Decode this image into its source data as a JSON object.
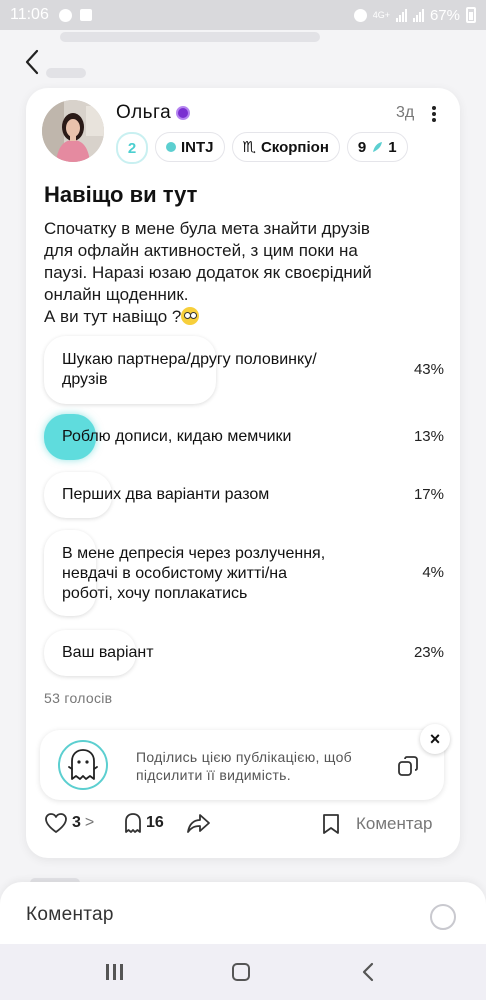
{
  "status_bar": {
    "time": "11:06",
    "network": "4G+",
    "battery": "67%"
  },
  "post": {
    "author": "Ольга",
    "time_ago": "3д",
    "level": "2",
    "mbti": "INTJ",
    "zodiac_symbol": "♏",
    "zodiac": "Скорпіон",
    "stat_left": "9",
    "stat_right": "1",
    "title": "Навіщо ви тут",
    "body": "Спочатку в мене була мета знайти друзів\nдля офлайн активностей, з цим поки на\nпаузі. Наразі юзаю додаток як своєрідний\nонлайн щоденник.\nА ви тут навіщо ?"
  },
  "poll": {
    "options": [
      {
        "text": "Шукаю партнера/другу половинку/\nдрузів",
        "percent_label": "43%",
        "percent": 43,
        "selected": false
      },
      {
        "text": "Роблю дописи, кидаю мемчики",
        "percent_label": "13%",
        "percent": 13,
        "selected": true
      },
      {
        "text": "Перших два варіанти разом",
        "percent_label": "17%",
        "percent": 17,
        "selected": false
      },
      {
        "text": "В мене депресія через розлучення,\nневдачі в особистому житті/на\nроботі, хочу поплакатись",
        "percent_label": "4%",
        "percent": 4,
        "selected": false
      },
      {
        "text": "Ваш варіант",
        "percent_label": "23%",
        "percent": 23,
        "selected": false
      }
    ],
    "votes_label": "53 голосів"
  },
  "share": {
    "text": "Поділись цією публікацією, щоб\nпідсилити її видимість.",
    "close_glyph": "×"
  },
  "actions": {
    "likes": "3",
    "chevron": ">",
    "views": "16",
    "comment_label": "Коментар"
  },
  "comment_input": {
    "placeholder": "Коментар"
  },
  "colors": {
    "accent": "#5fdcdd",
    "verified": "#7a2fd1"
  }
}
